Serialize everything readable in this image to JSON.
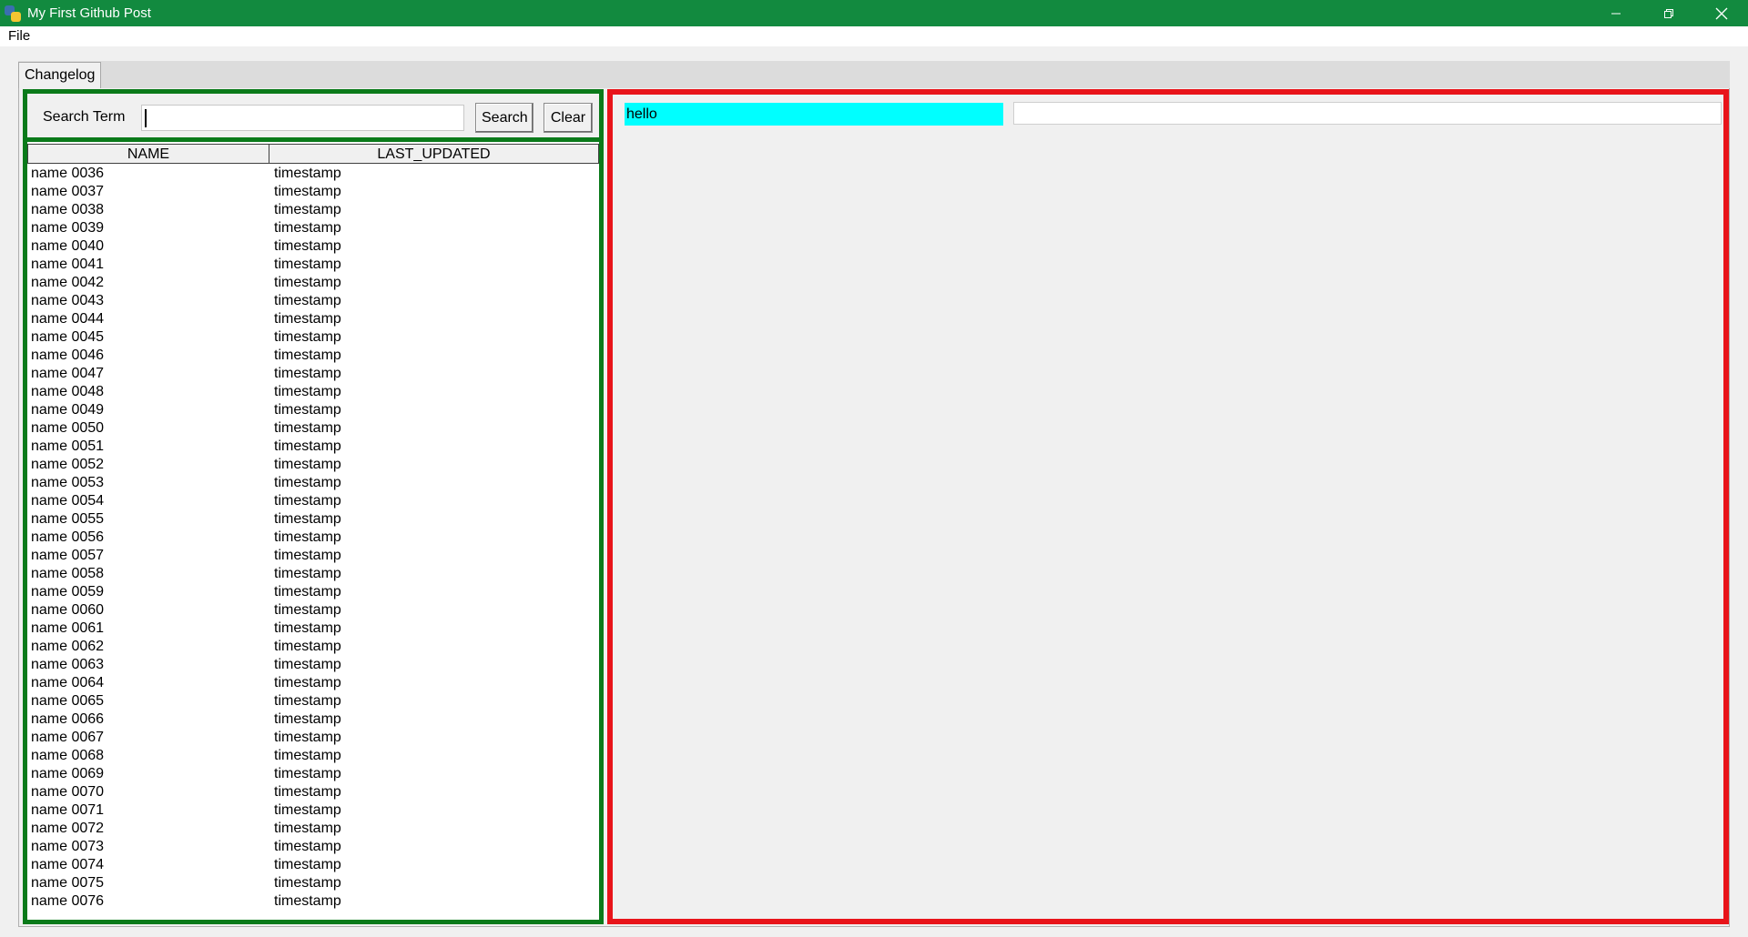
{
  "window": {
    "title": "My First Github Post",
    "minimize_icon": "minimize-icon",
    "maximize_icon": "restore-icon",
    "close_icon": "close-icon",
    "titlebar_color": "#128a3f"
  },
  "menu": {
    "items": [
      {
        "label": "File"
      }
    ]
  },
  "tabs": [
    {
      "label": "Changelog",
      "active": true
    }
  ],
  "left_panel": {
    "border_color": "#0a7a1a",
    "search_label": "Search Term",
    "search_value": "",
    "search_button": "Search",
    "clear_button": "Clear",
    "columns": [
      "NAME",
      "LAST_UPDATED"
    ],
    "rows": [
      {
        "name": "name 0036",
        "updated": "timestamp"
      },
      {
        "name": "name 0037",
        "updated": "timestamp"
      },
      {
        "name": "name 0038",
        "updated": "timestamp"
      },
      {
        "name": "name 0039",
        "updated": "timestamp"
      },
      {
        "name": "name 0040",
        "updated": "timestamp"
      },
      {
        "name": "name 0041",
        "updated": "timestamp"
      },
      {
        "name": "name 0042",
        "updated": "timestamp"
      },
      {
        "name": "name 0043",
        "updated": "timestamp"
      },
      {
        "name": "name 0044",
        "updated": "timestamp"
      },
      {
        "name": "name 0045",
        "updated": "timestamp"
      },
      {
        "name": "name 0046",
        "updated": "timestamp"
      },
      {
        "name": "name 0047",
        "updated": "timestamp"
      },
      {
        "name": "name 0048",
        "updated": "timestamp"
      },
      {
        "name": "name 0049",
        "updated": "timestamp"
      },
      {
        "name": "name 0050",
        "updated": "timestamp"
      },
      {
        "name": "name 0051",
        "updated": "timestamp"
      },
      {
        "name": "name 0052",
        "updated": "timestamp"
      },
      {
        "name": "name 0053",
        "updated": "timestamp"
      },
      {
        "name": "name 0054",
        "updated": "timestamp"
      },
      {
        "name": "name 0055",
        "updated": "timestamp"
      },
      {
        "name": "name 0056",
        "updated": "timestamp"
      },
      {
        "name": "name 0057",
        "updated": "timestamp"
      },
      {
        "name": "name 0058",
        "updated": "timestamp"
      },
      {
        "name": "name 0059",
        "updated": "timestamp"
      },
      {
        "name": "name 0060",
        "updated": "timestamp"
      },
      {
        "name": "name 0061",
        "updated": "timestamp"
      },
      {
        "name": "name 0062",
        "updated": "timestamp"
      },
      {
        "name": "name 0063",
        "updated": "timestamp"
      },
      {
        "name": "name 0064",
        "updated": "timestamp"
      },
      {
        "name": "name 0065",
        "updated": "timestamp"
      },
      {
        "name": "name 0066",
        "updated": "timestamp"
      },
      {
        "name": "name 0067",
        "updated": "timestamp"
      },
      {
        "name": "name 0068",
        "updated": "timestamp"
      },
      {
        "name": "name 0069",
        "updated": "timestamp"
      },
      {
        "name": "name 0070",
        "updated": "timestamp"
      },
      {
        "name": "name 0071",
        "updated": "timestamp"
      },
      {
        "name": "name 0072",
        "updated": "timestamp"
      },
      {
        "name": "name 0073",
        "updated": "timestamp"
      },
      {
        "name": "name 0074",
        "updated": "timestamp"
      },
      {
        "name": "name 0075",
        "updated": "timestamp"
      },
      {
        "name": "name 0076",
        "updated": "timestamp"
      }
    ]
  },
  "right_panel": {
    "border_color": "#e8141a",
    "label": "hello",
    "label_background": "#00ffff",
    "entry_value": ""
  }
}
